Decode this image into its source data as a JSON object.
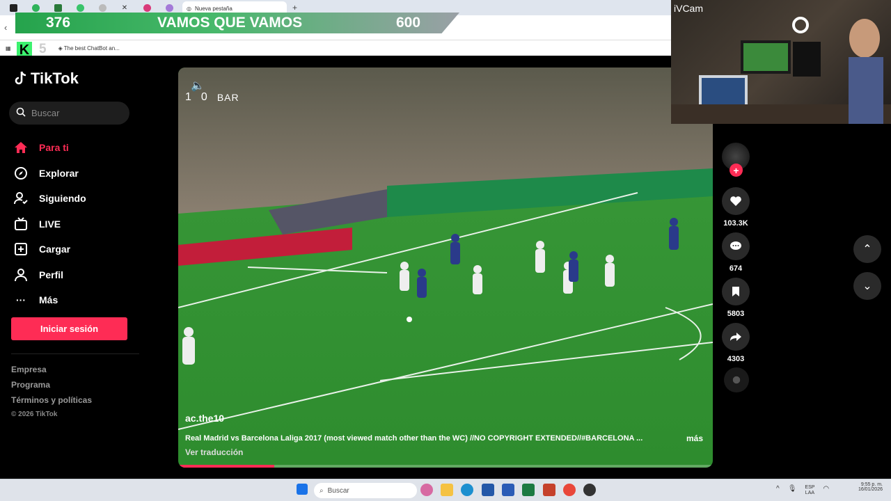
{
  "browser": {
    "active_tab_title": "Nueva pestaña",
    "bookmark": "The best ChatBot an..."
  },
  "stream_banner": {
    "left_number": "376",
    "center_text": "VAMOS QUE VAMOS",
    "right_number": "600",
    "logo_letter": "K",
    "logo_number": "5"
  },
  "webcam": {
    "label": "iVCam"
  },
  "tiktok": {
    "brand": "TikTok",
    "search_placeholder": "Buscar",
    "nav": [
      {
        "label": "Para ti",
        "icon": "home-icon",
        "active": true
      },
      {
        "label": "Explorar",
        "icon": "compass-icon",
        "active": false
      },
      {
        "label": "Siguiendo",
        "icon": "user-follow-icon",
        "active": false
      },
      {
        "label": "LIVE",
        "icon": "tv-icon",
        "active": false
      },
      {
        "label": "Cargar",
        "icon": "upload-plus-icon",
        "active": false
      },
      {
        "label": "Perfil",
        "icon": "user-icon",
        "active": false
      },
      {
        "label": "Más",
        "icon": "more-dots-icon",
        "active": false
      }
    ],
    "login_button": "Iniciar sesión",
    "footer": [
      "Empresa",
      "Programa",
      "Términos y políticas"
    ],
    "copyright": "© 2026 TikTok",
    "accent_color": "#fe2c55"
  },
  "video": {
    "score_home": "1",
    "score_away": "0",
    "away_team": "BAR",
    "username": "ac.the10",
    "description": "Real Madrid vs Barcelona Laliga 2017 (most viewed match other than the WC) //NO COPYRIGHT EXTENDED//#BARCELONA ...",
    "more_label": "más",
    "translate_label": "Ver traducción",
    "progress": 0.18,
    "likes": "103.3K",
    "comments": "674",
    "saves": "5803",
    "shares": "4303"
  },
  "taskbar": {
    "search_placeholder": "Buscar",
    "language": "ESP",
    "language_sub": "LAA",
    "time": "9:55 p. m.",
    "date": "16/01/2026"
  }
}
